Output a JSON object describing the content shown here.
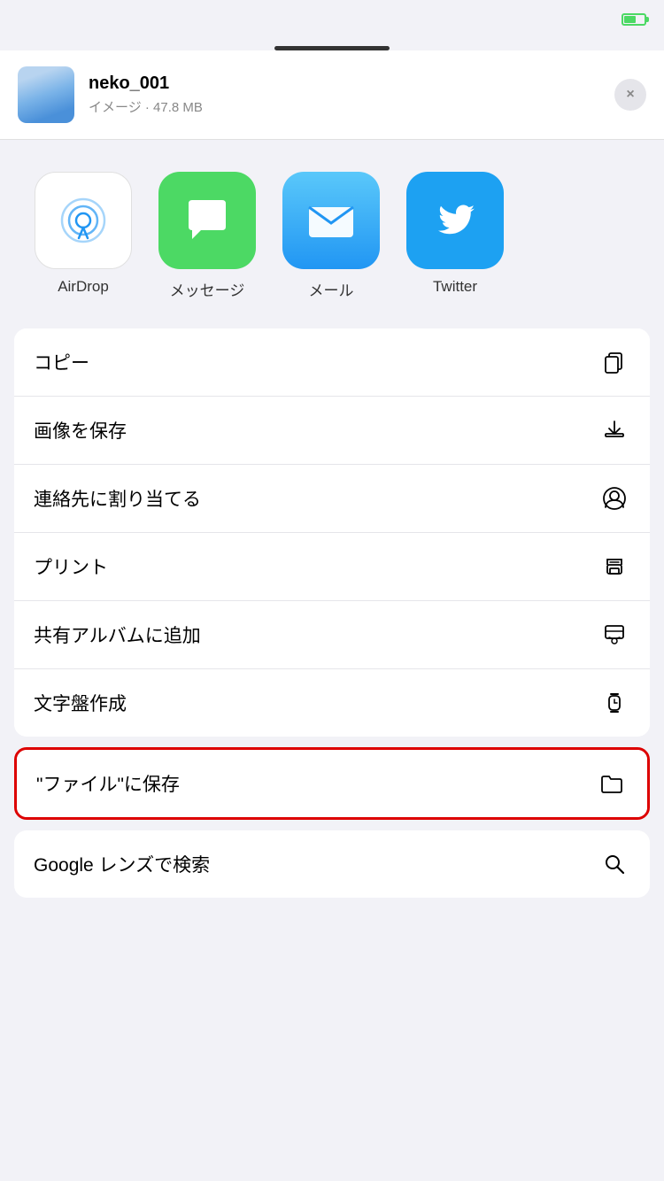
{
  "statusBar": {
    "batteryColor": "#4cd964"
  },
  "header": {
    "title": "neko_001",
    "subtitle": "イメージ · 47.8 MB",
    "closeLabel": "×"
  },
  "apps": [
    {
      "id": "airdrop",
      "label": "AirDrop",
      "type": "airdrop"
    },
    {
      "id": "messages",
      "label": "メッセージ",
      "type": "messages"
    },
    {
      "id": "mail",
      "label": "メール",
      "type": "mail"
    },
    {
      "id": "twitter",
      "label": "Twitter",
      "type": "twitter"
    }
  ],
  "actions": [
    {
      "id": "copy",
      "label": "コピー",
      "icon": "copy"
    },
    {
      "id": "save-image",
      "label": "画像を保存",
      "icon": "save"
    },
    {
      "id": "assign-contact",
      "label": "連絡先に割り当てる",
      "icon": "contact"
    },
    {
      "id": "print",
      "label": "プリント",
      "icon": "print"
    },
    {
      "id": "shared-album",
      "label": "共有アルバムに追加",
      "icon": "album"
    },
    {
      "id": "watch-face",
      "label": "文字盤作成",
      "icon": "watch"
    }
  ],
  "highlightedAction": {
    "id": "save-files",
    "label": "\"ファイル\"に保存",
    "icon": "folder"
  },
  "bottomActions": [
    {
      "id": "google-lens",
      "label": "Google レンズで検索",
      "icon": "search"
    }
  ]
}
